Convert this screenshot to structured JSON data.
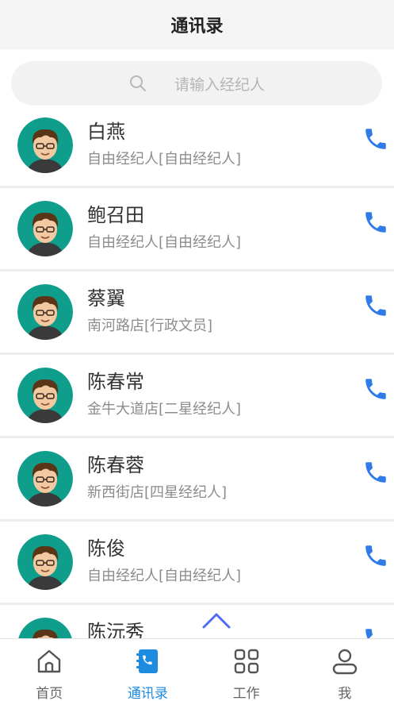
{
  "header": {
    "title": "通讯录"
  },
  "search": {
    "placeholder": "请输入经纪人"
  },
  "contacts": [
    {
      "name": "白燕",
      "sub": "自由经纪人[自由经纪人]"
    },
    {
      "name": "鲍召田",
      "sub": "自由经纪人[自由经纪人]"
    },
    {
      "name": "蔡翼",
      "sub": "南河路店[行政文员]"
    },
    {
      "name": "陈春常",
      "sub": "金牛大道店[二星经纪人]"
    },
    {
      "name": "陈春蓉",
      "sub": "新西街店[四星经纪人]"
    },
    {
      "name": "陈俊",
      "sub": "自由经纪人[自由经纪人]"
    },
    {
      "name": "陈沅秀",
      "sub": ""
    }
  ],
  "tabs": [
    {
      "label": "首页",
      "icon": "home-icon"
    },
    {
      "label": "通讯录",
      "icon": "contacts-book-icon"
    },
    {
      "label": "工作",
      "icon": "grid-icon"
    },
    {
      "label": "我",
      "icon": "user-icon"
    }
  ],
  "colors": {
    "accent": "#1c8be0",
    "phone": "#2f7be8"
  }
}
